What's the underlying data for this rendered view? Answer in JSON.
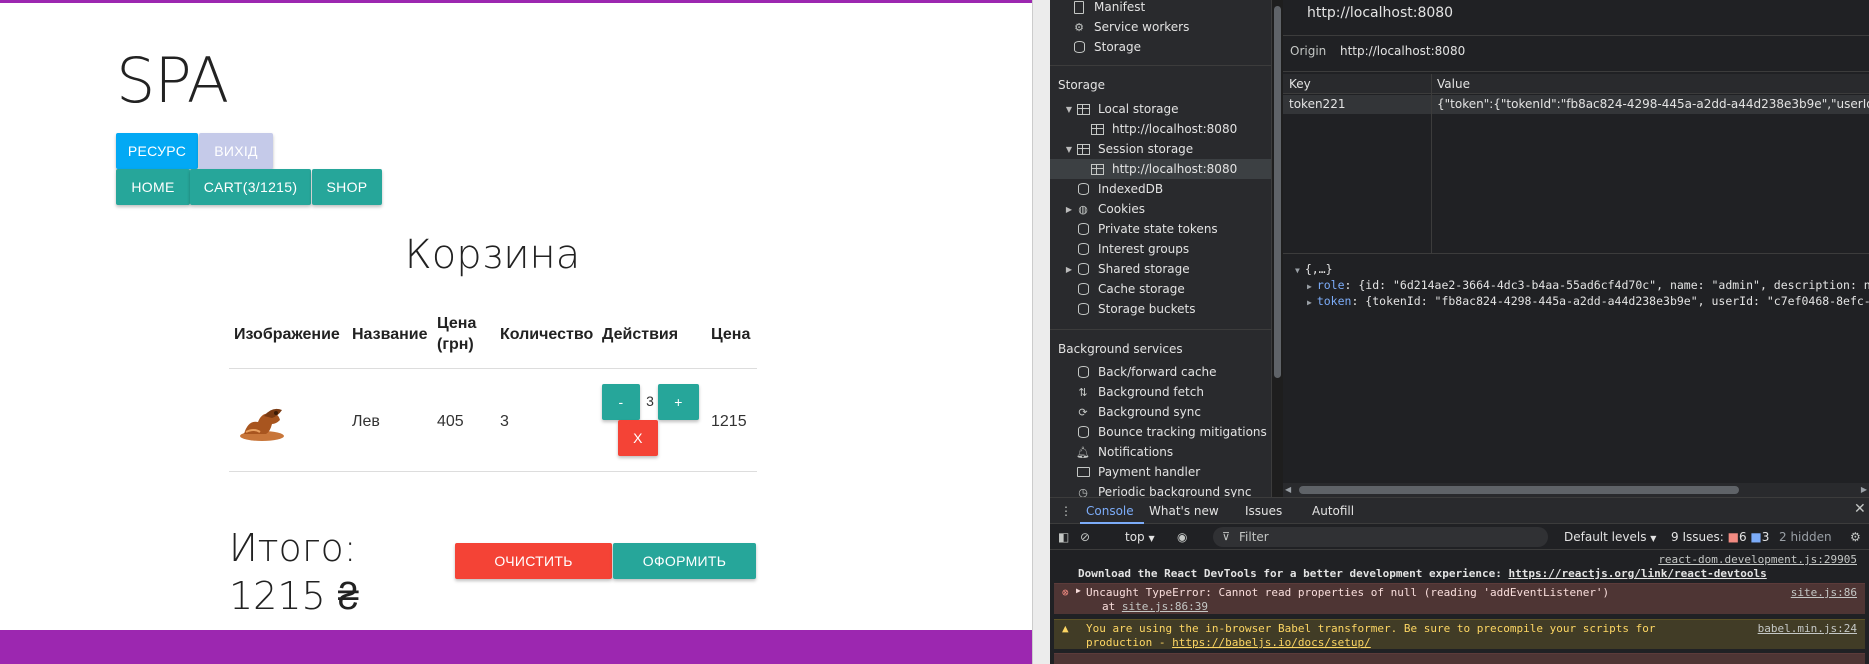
{
  "page": {
    "title": "SPA",
    "nav_row1": [
      "РЕСУРС",
      "ВИХІД"
    ],
    "nav_row2": [
      "HOME",
      "CART(3/1215)",
      "SHOP"
    ],
    "cart_heading": "Корзина",
    "table_headers": [
      "Изображение",
      "Название",
      "Цена (грн)",
      "Количество",
      "Действия",
      "Цена"
    ],
    "row": {
      "name": "Лев",
      "price": "405",
      "quantity": "3",
      "minus": "-",
      "qty_display": "3",
      "plus": "+",
      "remove": "X",
      "total": "1215"
    },
    "total_label": "Итого:",
    "total_value": "1215 ₴",
    "clear_button": "ОЧИСТИТЬ",
    "checkout_button": "ОФОРМИТЬ",
    "colors": {
      "accent_purple": "#9c27b0",
      "teal": "#26a69a",
      "red": "#f44336",
      "blue": "#03a9f4"
    }
  },
  "devtools": {
    "sidebar": {
      "top_items": [
        "Manifest",
        "Service workers",
        "Storage"
      ],
      "storage_header": "Storage",
      "storage_items": [
        "Local storage",
        "http://localhost:8080",
        "Session storage",
        "http://localhost:8080",
        "IndexedDB",
        "Cookies",
        "Private state tokens",
        "Interest groups",
        "Shared storage",
        "Cache storage",
        "Storage buckets"
      ],
      "background_header": "Background services",
      "background_items": [
        "Back/forward cache",
        "Background fetch",
        "Background sync",
        "Bounce tracking mitigations",
        "Notifications",
        "Payment handler",
        "Periodic background sync"
      ]
    },
    "storage_view": {
      "url": "http://localhost:8080",
      "origin_label": "Origin",
      "origin_value": "http://localhost:8080",
      "col_key": "Key",
      "col_value": "Value",
      "row_key": "token221",
      "row_value": "{\"token\":{\"tokenId\":\"fb8ac824-4298-445a-a2dd-a44d238e3b9e\",\"userId\":\"c7e...",
      "tree_root": "{,…}",
      "tree_role_key": "role",
      "tree_role_val": ": {id: \"6d214ae2-3664-4dc3-b4aa-55ad6cf4d70c\", name: \"admin\", description: null",
      "tree_token_key": "token",
      "tree_token_val": ": {tokenId: \"fb8ac824-4298-445a-a2dd-a44d238e3b9e\", userId: \"c7ef0468-8efc-4ae"
    },
    "drawer": {
      "tabs": [
        "Console",
        "What's new",
        "Issues",
        "Autofill"
      ],
      "context": "top",
      "filter_placeholder": "Filter",
      "levels": "Default levels",
      "issues_label": "9 Issues:",
      "issues_err": "6",
      "issues_info": "3",
      "hidden": "2 hidden",
      "msg1_source": "react-dom.development.js:29905",
      "msg1_text": "Download the React DevTools for a better development experience: ",
      "msg1_link": "https://reactjs.org/link/react-devtools",
      "msg2_text": "Uncaught TypeError: Cannot read properties of null (reading 'addEventListener')",
      "msg2_at": "at ",
      "msg2_at_link": "site.js:86:39",
      "msg2_source": "site.js:86",
      "msg3_text": "You are using the in-browser Babel transformer. Be sure to precompile your scripts for",
      "msg3_text2": "production - ",
      "msg3_link": "https://babeljs.io/docs/setup/",
      "msg3_source": "babel.min.js:24"
    }
  }
}
